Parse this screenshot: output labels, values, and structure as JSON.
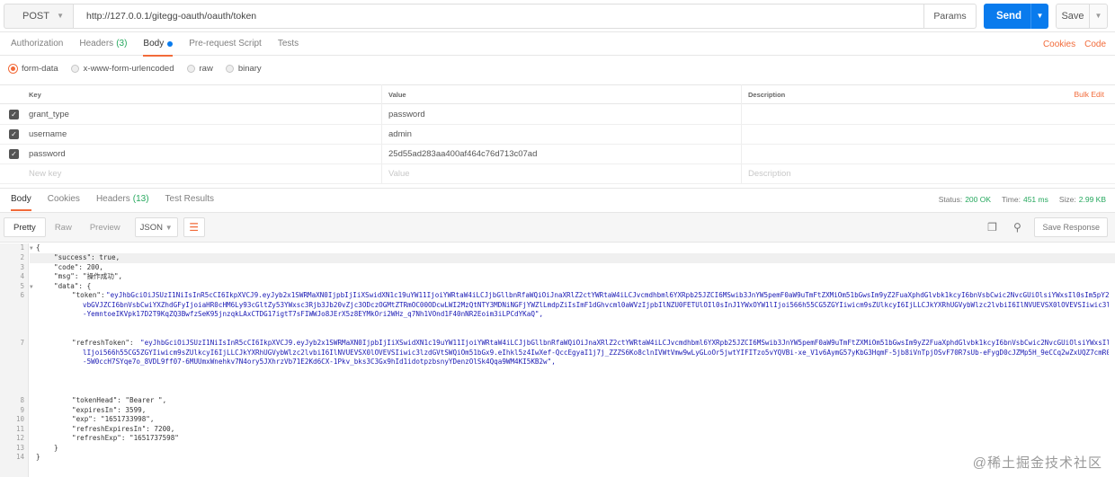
{
  "request": {
    "method": "POST",
    "url": "http://127.0.0.1/gitegg-oauth/oauth/token",
    "params_label": "Params",
    "send_label": "Send",
    "save_label": "Save"
  },
  "request_tabs": {
    "authorization": "Authorization",
    "headers": "Headers",
    "headers_count": "(3)",
    "body": "Body",
    "prerequest": "Pre-request Script",
    "tests": "Tests",
    "cookies": "Cookies",
    "code": "Code"
  },
  "body_types": {
    "form_data": "form-data",
    "urlencoded": "x-www-form-urlencoded",
    "raw": "raw",
    "binary": "binary"
  },
  "kv_table": {
    "headers": {
      "key": "Key",
      "value": "Value",
      "description": "Description",
      "bulk_edit": "Bulk Edit"
    },
    "rows": [
      {
        "key": "grant_type",
        "value": "password",
        "description": ""
      },
      {
        "key": "username",
        "value": "admin",
        "description": ""
      },
      {
        "key": "password",
        "value": "25d55ad283aa400af464c76d713c07ad",
        "description": ""
      }
    ],
    "placeholder": {
      "key": "New key",
      "value": "Value",
      "description": "Description"
    }
  },
  "response_tabs": {
    "body": "Body",
    "cookies": "Cookies",
    "headers": "Headers",
    "headers_count": "(13)",
    "test_results": "Test Results",
    "status_label": "Status:",
    "status_value": "200 OK",
    "time_label": "Time:",
    "time_value": "451 ms",
    "size_label": "Size:",
    "size_value": "2.99 KB"
  },
  "response_toolbar": {
    "pretty": "Pretty",
    "raw": "Raw",
    "preview": "Preview",
    "format": "JSON",
    "save_response": "Save Response"
  },
  "code": {
    "line_numbers": [
      "1",
      "2",
      "3",
      "4",
      "5",
      "6",
      "7",
      "8",
      "9",
      "10",
      "11",
      "12",
      "13",
      "14",
      "15",
      "16"
    ],
    "l1": "{",
    "l2": "\"success\": true,",
    "l3": "\"code\": 200,",
    "l4": "\"msg\": \"操作成功\",",
    "l5": "\"data\": {",
    "token_prefix": "\"token\": ",
    "token_lines": [
      "\"eyJhbGciOiJSUzI1NiIsInR5cCI6IkpXVCJ9.eyJyb2x1SWRMaXN0IjpbIjIiXSwidXN1c19uYW11IjoiYWRtaW4iLCJjbGllbnRfaWQiOiJnaXRlZ2ctYWRtaW4iLCJvcmdhbml6YXRpb25JZCI6MSwib3JnYW5pemF0aW9uTmFtZXMiOm51bGwsIm9yZ2FuaXphdGlvbk1kcyI6bnVsbCwic2NvcGUiOlsiYWxsIl0sIm5pY2tuYW1lIjoi566h55CG5ZGYIiwib3JnYW5pemF0aW9uSWRMaXN0IjpudWxsLCJvYXV0aF9pZCI6bnVsbCwiaWQiOjEsImV4cCI6MTY1MTczMzk5OCwianRpIjoiNzA5TkxYzktNzg3ZS00ZGM5LTkyMzMtNjJlYTYxOTVhMDQxIiwib3JnYW5pemF0aW9uTmFtZSI6IuaciemZkOWFrOWPuCIsInJ",
      "vbGVJZCI6bnVsbCwiYXZhdGFyIjoiaHR0cHM6Ly93cGltZy53YWxsc3Rjb3Jb20vZjc3ODczOGMtZTRmOC00ODcwLWI2MzQtNTY3MDNiNGFjYWZlLmdpZiIsImF1dGhvcml0aWVzIjpbIlNZU0FETUlOIl0sInJ1YWxOYW1lIjoi566h55CG5ZGYIiwicm9sZUlkcyI6IjLLCJkYXRhUGVybWlzc2lvbiI6IlNVUEVSX0lOVEVSIiwic3lzdGVtSWQiOm51bGx9",
      "-YemntoeIKVpk17D2T9KqZQ3BwfzSeK95jnzqkLAxCTDG17igtT7sFIWWJo8JErX5z8EYMkOri2WHz_q7Nh1VOnd1F40nNR2Eoim3iLPCdYKaQ\","
    ],
    "refresh_prefix": "\"refreshToken\": ",
    "refresh_lines": [
      "\"eyJhbGciOiJSUzI1NiIsInR5cCI6IkpXVCJ9.eyJyb2x1SWRMaXN0IjpbIjIiXSwidXN1c19uYW11IjoiYWRtaW4iLCJjbGllbnRfaWQiOiJnaXRlZ2ctYWRtaW4iLCJvcmdhbml6YXRpb25JZCI6MSwib3JnYW5pemF0aW9uTmFtZXMiOm51bGwsIm9yZ2FuaXphdGlvbk1kcyI6bnVsbCwic2NvcGUiOlsiYWxsIl0sImF0aSI6IjcwOWU5MWU5LTc4N2UtNGRjOS05MjMzLTYyZWE2MTk1YTA0MSIsIm5pY2tuYW1lIjoi566h55CG5ZGYIiwib3JnYW5pemF0aW9uSWRMaXN0IjpudWxsLCJvYXV0aF9pZCI6bnVsbCwiaWQiOjEsImV4cCI6MTY1MTczNzU5OCwianRpIjoiNmE0ZDl1MmItOWE4Mi00ZjA3LTk1OWUtNWRmMTRiZDBiMTZjIiwib3JnYW5pemF0aW9uTmFtZSI6IuaciemZkOWFrOWPuCIsInJvbGVJZCI6bnVsbCwiYXZhdGFyIjoiaHR0cHM6Ly93cGltZy53YWxsc3Rjb3Jb20vZjc3ODczOGMtZTRmOC00ODcwLWI2MzQtNTY3MDNiNGFjYWZlLmdpZiIsImF1dGhvcml0aWVzIjpbIlNZU0FETUlOIl0sInJ1YWxOYW1",
      "lIjoi566h55CG5ZGYIiwicm9sZUlkcyI6IjLLCJkYXRhUGVybWlzc2lvbiI6IlNVUEVSX0lOVEVSIiwic3lzdGVtSWQiOm51bGx9.eIhkl5z4IwXef-QccEgyaI1j7j_ZZZS6Ko8clnIVWtVmw9wLyGLoOr5jwtYIFITzo5vYQVBi-xe_V1v6AymG57yKbG3HqmF-5jb8iVnTpjOSvF70R7sUb-eFygD0cJZMp5H_9eCCq2wZxUQZ7cmR0mbeuMz1Ro7JCO86kH5ktTak811TF9oDxM3yTwF8XOMog_aTOGhXrPk5jDdBeyKleq2ILbelwr_dn8X4",
      "-5W0ccH7SYqe7o_8VDL9ff07-6MUUmxWnehkv7N4ory5JXhrzVb71E2Kd6CX-1Pkv_bks3C3Gx9hId1idotpzbsnyYDenzOlSk4Qqa9WM4KI5KB2w\","
    ],
    "l8": "\"tokenHead\": \"Bearer \",",
    "l9": "\"expiresIn\": 3599,",
    "l10": "\"exp\": \"1651733998\",",
    "l11": "\"refreshExpiresIn\": 7200,",
    "l12": "\"refreshExp\": \"1651737598\"",
    "l13": "}",
    "l14": "}"
  },
  "watermark": "@稀土掘金技术社区",
  "colors": {
    "accent": "#f26b3a",
    "send": "#097bed",
    "ok": "#26a85e",
    "json_key": "#1a1ab4"
  }
}
